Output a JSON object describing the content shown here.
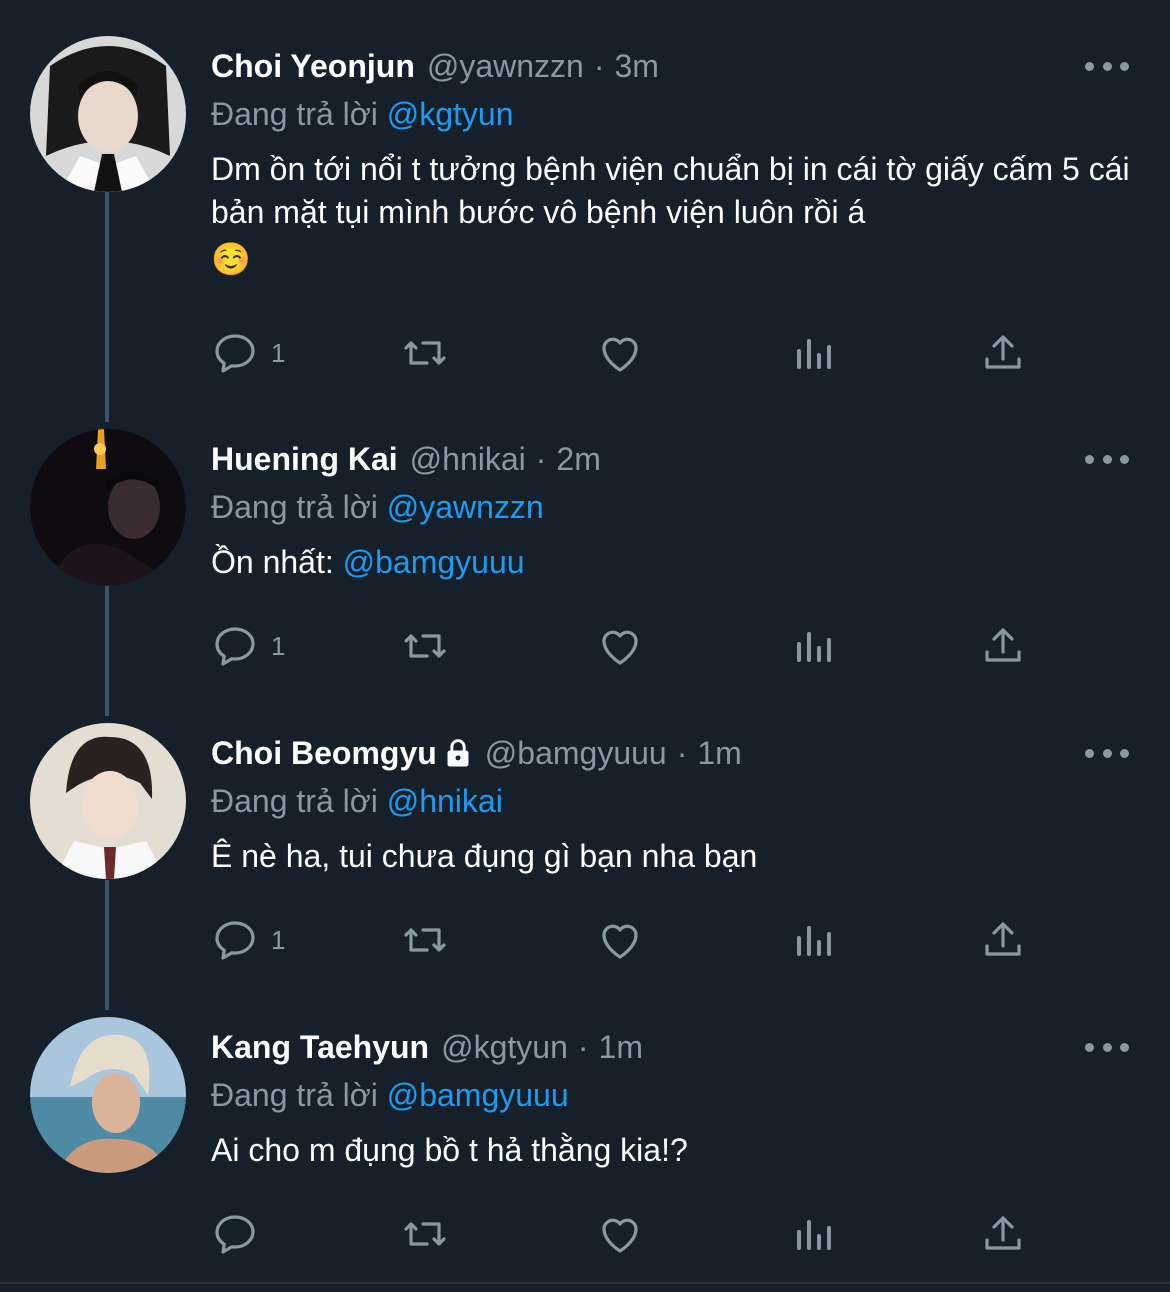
{
  "tweets": [
    {
      "name": "Choi Yeonjun",
      "handle": "@yawnzzn",
      "time": "3m",
      "reply_prefix": "Đang trả lời",
      "reply_to": "@kgtyun",
      "text": "Dm ồn tới nổi t tưởng bệnh viện chuẩn bị in cái tờ giấy cấm 5 cái bản mặt tụi mình bước vô bệnh viện luôn rồi á",
      "emoji": "☺️",
      "reply_count": "1",
      "locked": false
    },
    {
      "name": "Huening Kai",
      "handle": "@hnikai",
      "time": "2m",
      "reply_prefix": "Đang trả lời",
      "reply_to": "@yawnzzn",
      "text_prefix": "Ồn nhất: ",
      "text_mention": "@bamgyuuu",
      "reply_count": "1",
      "locked": false
    },
    {
      "name": "Choi Beomgyu",
      "handle": "@bamgyuuu",
      "time": "1m",
      "reply_prefix": "Đang trả lời",
      "reply_to": "@hnikai",
      "text": "Ê nè ha, tui chưa đụng gì bạn nha bạn",
      "reply_count": "1",
      "locked": true
    },
    {
      "name": "Kang Taehyun",
      "handle": "@kgtyun",
      "time": "1m",
      "reply_prefix": "Đang trả lời",
      "reply_to": "@bamgyuuu",
      "text": "Ai cho m đụng bồ t hả thằng kia!?",
      "reply_count": "",
      "locked": false
    }
  ],
  "separator": "·",
  "icons": [
    "reply-icon",
    "retweet-icon",
    "like-icon",
    "analytics-icon",
    "share-icon",
    "more-icon",
    "lock-icon"
  ],
  "colors": {
    "background": "#15202b",
    "mention": "#1d9bf0",
    "muted": "#8899a6",
    "text": "#ffffff"
  }
}
